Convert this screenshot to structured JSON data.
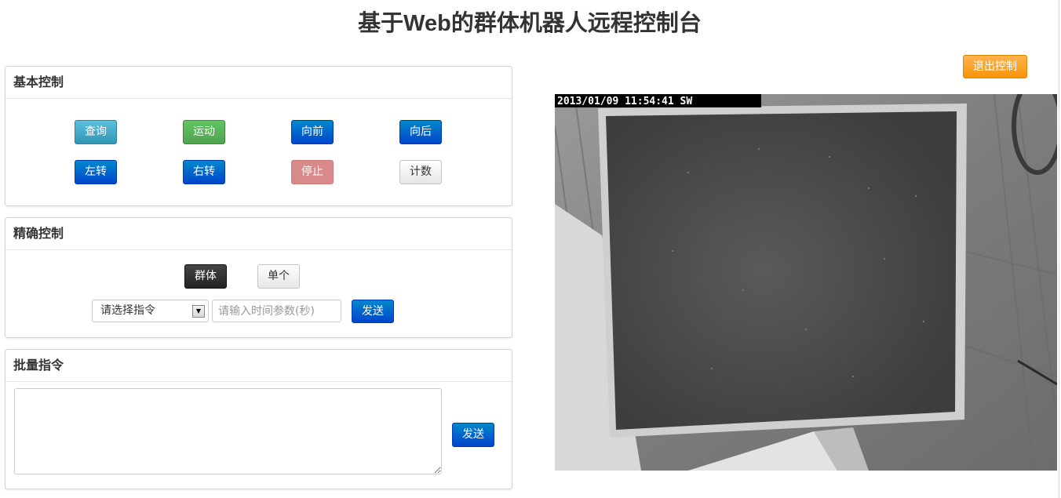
{
  "header": {
    "title_prefix": "基于",
    "title_bold": "Web",
    "title_suffix": "的群体机器人远程控制台"
  },
  "exit_button_label": "退出控制",
  "basic_control": {
    "title": "基本控制",
    "buttons": [
      "查询",
      "运动",
      "向前",
      "向后",
      "左转",
      "右转",
      "停止",
      "计数"
    ]
  },
  "precise_control": {
    "title": "精确控制",
    "mode_group": "群体",
    "mode_single": "单个",
    "select_value": "请选择指令",
    "time_placeholder": "请输入时间参数(秒)",
    "send_label": "发送"
  },
  "batch_commands": {
    "title": "批量指令",
    "textarea_value": "",
    "send_label": "发送"
  },
  "camera": {
    "timestamp": "2013/01/09 11:54:41 SW"
  }
}
